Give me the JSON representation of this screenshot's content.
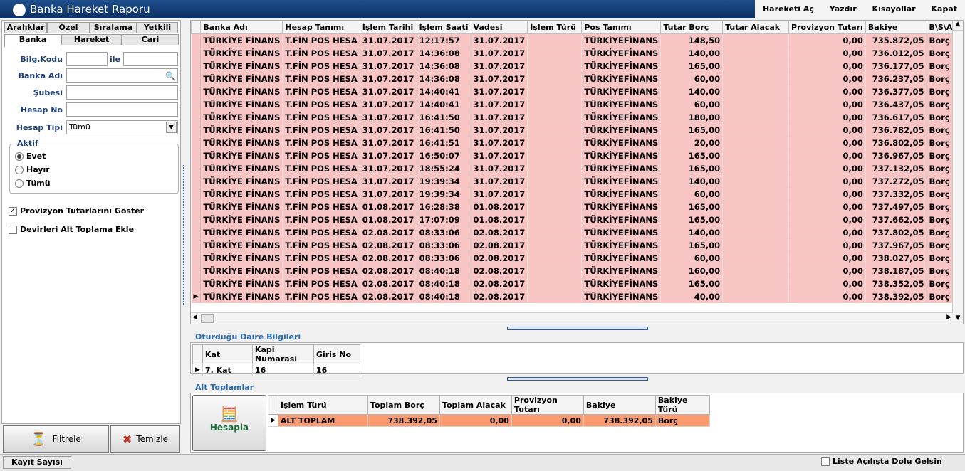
{
  "window": {
    "title": "Banka Hareket Raporu"
  },
  "menu": {
    "items": [
      "Hareketi Aç",
      "Yazdır",
      "Kısayollar",
      "Kapat"
    ]
  },
  "left": {
    "tabs_top": [
      "Aralıklar",
      "Özel",
      "Sıralama",
      "Yetkili"
    ],
    "tabs_bottom": [
      "Banka",
      "Hareket",
      "Cari"
    ],
    "labels": {
      "bilg_kodu": "Bilg.Kodu",
      "ile": "ile",
      "banka_adi": "Banka Adı",
      "subesi": "Şubesi",
      "hesap_no": "Hesap No",
      "hesap_tipi": "Hesap Tipi"
    },
    "hesap_tipi_value": "Tümü",
    "aktif": {
      "title": "Aktif",
      "options": [
        "Evet",
        "Hayır",
        "Tümü"
      ]
    },
    "provizyon": "Provizyon Tutarlarını Göster",
    "devir": "Devirleri Alt Toplama Ekle",
    "filtrele": "Filtrele",
    "temizle": "Temizle"
  },
  "grid": {
    "columns": [
      "Banka Adı",
      "Hesap Tanımı",
      "İşlem Tarihi",
      "İşlem Saati",
      "Vadesi",
      "İşlem Türü",
      "Pos Tanımı",
      "Tutar Borç",
      "Tutar Alacak",
      "Provizyon Tutarı",
      "Bakiye",
      "B\\S\\A"
    ],
    "rows": [
      [
        "TÜRKİYE FİNANS",
        "T.FİN POS HESA",
        "31.07.2017",
        "12:17:57",
        "31.07.2017",
        "",
        "TÜRKİYEFİNANS",
        "148,50",
        "",
        "0,00",
        "735.872,05",
        "Borç"
      ],
      [
        "TÜRKİYE FİNANS",
        "T.FİN POS HESA",
        "31.07.2017",
        "14:36:08",
        "31.07.2017",
        "",
        "TÜRKİYEFİNANS",
        "140,00",
        "",
        "0,00",
        "736.012,05",
        "Borç"
      ],
      [
        "TÜRKİYE FİNANS",
        "T.FİN POS HESA",
        "31.07.2017",
        "14:36:08",
        "31.07.2017",
        "",
        "TÜRKİYEFİNANS",
        "165,00",
        "",
        "0,00",
        "736.177,05",
        "Borç"
      ],
      [
        "TÜRKİYE FİNANS",
        "T.FİN POS HESA",
        "31.07.2017",
        "14:36:08",
        "31.07.2017",
        "",
        "TÜRKİYEFİNANS",
        "60,00",
        "",
        "0,00",
        "736.237,05",
        "Borç"
      ],
      [
        "TÜRKİYE FİNANS",
        "T.FİN POS HESA",
        "31.07.2017",
        "14:40:41",
        "31.07.2017",
        "",
        "TÜRKİYEFİNANS",
        "140,00",
        "",
        "0,00",
        "736.377,05",
        "Borç"
      ],
      [
        "TÜRKİYE FİNANS",
        "T.FİN POS HESA",
        "31.07.2017",
        "14:40:41",
        "31.07.2017",
        "",
        "TÜRKİYEFİNANS",
        "60,00",
        "",
        "0,00",
        "736.437,05",
        "Borç"
      ],
      [
        "TÜRKİYE FİNANS",
        "T.FİN POS HESA",
        "31.07.2017",
        "16:41:50",
        "31.07.2017",
        "",
        "TÜRKİYEFİNANS",
        "180,00",
        "",
        "0,00",
        "736.617,05",
        "Borç"
      ],
      [
        "TÜRKİYE FİNANS",
        "T.FİN POS HESA",
        "31.07.2017",
        "16:41:50",
        "31.07.2017",
        "",
        "TÜRKİYEFİNANS",
        "165,00",
        "",
        "0,00",
        "736.782,05",
        "Borç"
      ],
      [
        "TÜRKİYE FİNANS",
        "T.FİN POS HESA",
        "31.07.2017",
        "16:41:51",
        "31.07.2017",
        "",
        "TÜRKİYEFİNANS",
        "20,00",
        "",
        "0,00",
        "736.802,05",
        "Borç"
      ],
      [
        "TÜRKİYE FİNANS",
        "T.FİN POS HESA",
        "31.07.2017",
        "16:50:07",
        "31.07.2017",
        "",
        "TÜRKİYEFİNANS",
        "165,00",
        "",
        "0,00",
        "736.967,05",
        "Borç"
      ],
      [
        "TÜRKİYE FİNANS",
        "T.FİN POS HESA",
        "31.07.2017",
        "18:55:24",
        "31.07.2017",
        "",
        "TÜRKİYEFİNANS",
        "165,00",
        "",
        "0,00",
        "737.132,05",
        "Borç"
      ],
      [
        "TÜRKİYE FİNANS",
        "T.FİN POS HESA",
        "31.07.2017",
        "19:39:34",
        "31.07.2017",
        "",
        "TÜRKİYEFİNANS",
        "140,00",
        "",
        "0,00",
        "737.272,05",
        "Borç"
      ],
      [
        "TÜRKİYE FİNANS",
        "T.FİN POS HESA",
        "31.07.2017",
        "19:39:34",
        "31.07.2017",
        "",
        "TÜRKİYEFİNANS",
        "60,00",
        "",
        "0,00",
        "737.332,05",
        "Borç"
      ],
      [
        "TÜRKİYE FİNANS",
        "T.FİN POS HESA",
        "01.08.2017",
        "16:28:38",
        "01.08.2017",
        "",
        "TÜRKİYEFİNANS",
        "165,00",
        "",
        "0,00",
        "737.497,05",
        "Borç"
      ],
      [
        "TÜRKİYE FİNANS",
        "T.FİN POS HESA",
        "01.08.2017",
        "17:07:09",
        "01.08.2017",
        "",
        "TÜRKİYEFİNANS",
        "165,00",
        "",
        "0,00",
        "737.662,05",
        "Borç"
      ],
      [
        "TÜRKİYE FİNANS",
        "T.FİN POS HESA",
        "02.08.2017",
        "08:33:06",
        "02.08.2017",
        "",
        "TÜRKİYEFİNANS",
        "140,00",
        "",
        "0,00",
        "737.802,05",
        "Borç"
      ],
      [
        "TÜRKİYE FİNANS",
        "T.FİN POS HESA",
        "02.08.2017",
        "08:33:06",
        "02.08.2017",
        "",
        "TÜRKİYEFİNANS",
        "165,00",
        "",
        "0,00",
        "737.967,05",
        "Borç"
      ],
      [
        "TÜRKİYE FİNANS",
        "T.FİN POS HESA",
        "02.08.2017",
        "08:33:06",
        "02.08.2017",
        "",
        "TÜRKİYEFİNANS",
        "60,00",
        "",
        "0,00",
        "738.027,05",
        "Borç"
      ],
      [
        "TÜRKİYE FİNANS",
        "T.FİN POS HESA",
        "02.08.2017",
        "08:40:18",
        "02.08.2017",
        "",
        "TÜRKİYEFİNANS",
        "160,00",
        "",
        "0,00",
        "738.187,05",
        "Borç"
      ],
      [
        "TÜRKİYE FİNANS",
        "T.FİN POS HESA",
        "02.08.2017",
        "08:40:18",
        "02.08.2017",
        "",
        "TÜRKİYEFİNANS",
        "165,00",
        "",
        "0,00",
        "738.352,05",
        "Borç"
      ],
      [
        "TÜRKİYE FİNANS",
        "T.FİN POS HESA",
        "02.08.2017",
        "08:40:18",
        "02.08.2017",
        "",
        "TÜRKİYEFİNANS",
        "40,00",
        "",
        "0,00",
        "738.392,05",
        "Borç"
      ]
    ]
  },
  "daire": {
    "title": "Oturduğu Daire Bilgileri",
    "columns": [
      "Kat",
      "Kapi Numarasi",
      "Giris No"
    ],
    "row": [
      "7. Kat",
      "16",
      "16"
    ]
  },
  "alt": {
    "title": "Alt Toplamlar",
    "hesapla": "Hesapla",
    "columns": [
      "İşlem Türü",
      "Toplam Borç",
      "Toplam Alacak",
      "Provizyon Tutarı",
      "Bakiye",
      "Bakiye Türü"
    ],
    "row": [
      "ALT TOPLAM",
      "738.392,05",
      "0,00",
      "0,00",
      "738.392,05",
      "Borç"
    ]
  },
  "status": {
    "kayit": "Kayıt Sayısı",
    "liste": "Liste Açılışta Dolu Gelsin"
  }
}
